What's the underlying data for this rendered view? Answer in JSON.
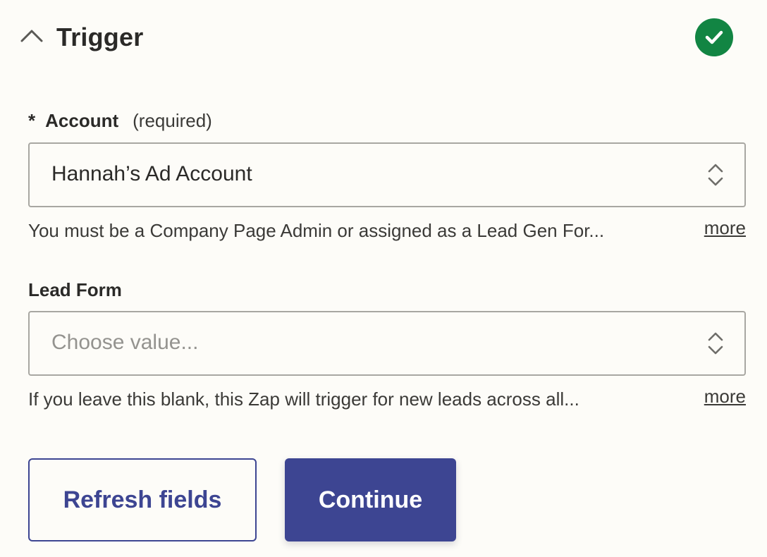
{
  "section": {
    "title": "Trigger",
    "status_color": "#128543",
    "collapse_icon": "chevron-up-icon",
    "status_icon": "check-circle-icon"
  },
  "account_field": {
    "required_marker": "*",
    "label": "Account",
    "required_hint": "(required)",
    "value": "Hannah’s Ad Account",
    "help_text": "You must be a Company Page Admin or assigned as a Lead Gen For...",
    "more_link": "more"
  },
  "lead_form_field": {
    "label": "Lead Form",
    "placeholder": "Choose value...",
    "help_text": "If you leave this blank, this Zap will trigger for new leads across all...",
    "more_link": "more"
  },
  "actions": {
    "refresh_label": "Refresh fields",
    "continue_label": "Continue",
    "accent_color": "#3d4592"
  }
}
